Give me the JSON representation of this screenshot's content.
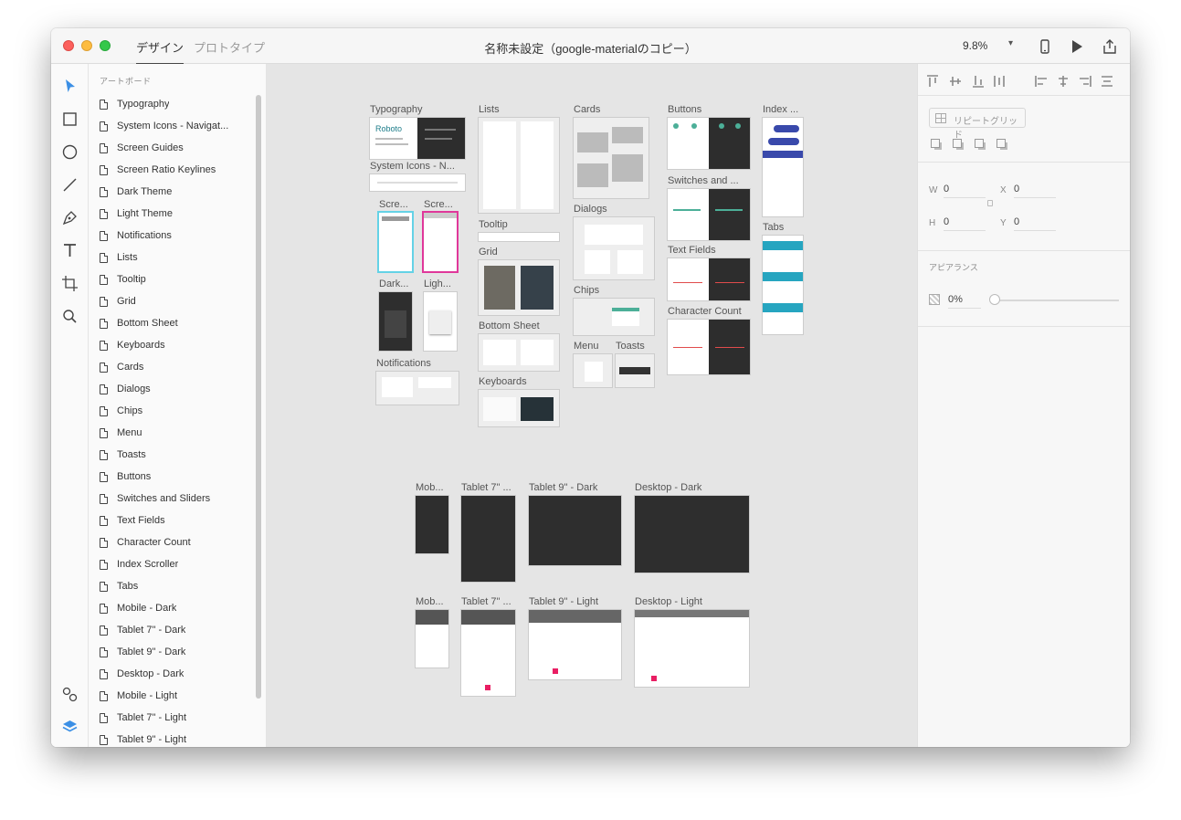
{
  "window": {
    "tabs": [
      "デザイン",
      "プロトタイプ"
    ],
    "active_tab": "デザイン",
    "title": "名称未設定（google-materialのコピー）",
    "zoom": "9.8%",
    "toolbar_icons": [
      "device-preview-icon",
      "play-icon",
      "share-icon"
    ]
  },
  "tools": [
    "select-tool-icon",
    "rectangle-tool-icon",
    "ellipse-tool-icon",
    "line-tool-icon",
    "pen-tool-icon",
    "text-tool-icon",
    "artboard-tool-icon",
    "zoom-tool-icon"
  ],
  "bottom_tools": [
    "symbols-icon",
    "layers-icon"
  ],
  "layers_panel": {
    "title": "アートボード",
    "items": [
      "Typography",
      "System Icons - Navigat...",
      "Screen Guides",
      "Screen Ratio Keylines",
      "Dark Theme",
      "Light Theme",
      "Notifications",
      "Lists",
      "Tooltip",
      "Grid",
      "Bottom Sheet",
      "Keyboards",
      "Cards",
      "Dialogs",
      "Chips",
      "Menu",
      "Toasts",
      "Buttons",
      "Switches and Sliders",
      "Text Fields",
      "Character Count",
      "Index Scroller",
      "Tabs",
      "Mobile - Dark",
      "Tablet 7\" - Dark",
      "Tablet 9\" - Dark",
      "Desktop - Dark",
      "Mobile - Light",
      "Tablet 7\" - Light",
      "Tablet 9\" - Light"
    ]
  },
  "canvas": {
    "artboards": {
      "typography": "Typography",
      "typography_sample": "Roboto",
      "system_icons": "System Icons - N...",
      "screen_guides": "Scre...",
      "screen_ratio": "Scre...",
      "dark_theme": "Dark...",
      "light_theme": "Ligh...",
      "notifications": "Notifications",
      "lists": "Lists",
      "tooltip": "Tooltip",
      "grid": "Grid",
      "bottom_sheet": "Bottom Sheet",
      "keyboards": "Keyboards",
      "cards": "Cards",
      "dialogs": "Dialogs",
      "chips": "Chips",
      "menu": "Menu",
      "toasts": "Toasts",
      "buttons": "Buttons",
      "switches": "Switches and ...",
      "text_fields": "Text Fields",
      "character_count": "Character Count",
      "index_scroller": "Index ...",
      "tabs": "Tabs",
      "mobile_dark": "Mob...",
      "tablet7_dark": "Tablet 7\" ...",
      "tablet9_dark": "Tablet 9\" - Dark",
      "desktop_dark": "Desktop - Dark",
      "mobile_light": "Mob...",
      "tablet7_light": "Tablet 7\" ...",
      "tablet9_light": "Tablet 9\" - Light",
      "desktop_light": "Desktop - Light"
    }
  },
  "properties": {
    "align_icons": [
      "align-top-icon",
      "align-middle-icon",
      "align-bottom-icon",
      "distribute-vertical-icon",
      "align-left-icon",
      "align-center-icon",
      "align-right-icon",
      "distribute-horizontal-icon"
    ],
    "repeat_grid": "リピートグリッド",
    "boolean_icons": [
      "add-icon",
      "subtract-icon",
      "intersect-icon",
      "exclude-icon"
    ],
    "w_label": "W",
    "w": "0",
    "h_label": "H",
    "h": "0",
    "x_label": "X",
    "x": "0",
    "y_label": "Y",
    "y": "0",
    "appearance_title": "アピアランス",
    "opacity": "0%"
  },
  "colors": {
    "accent": "#4a90e2",
    "close": "#fc605c",
    "minimize": "#fdbc40",
    "zoom": "#34c84a",
    "canvas": "#e5e5e5"
  }
}
